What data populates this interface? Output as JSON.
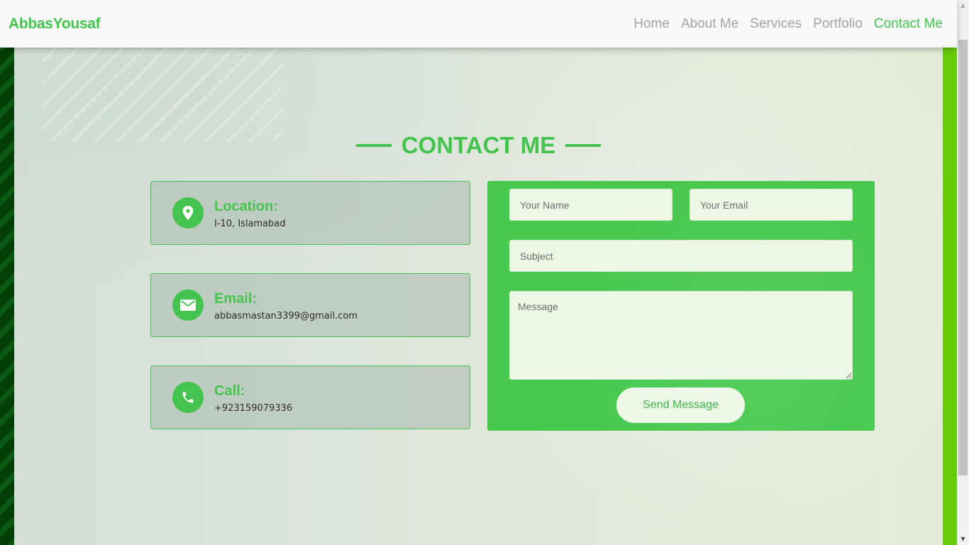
{
  "navbar": {
    "brand": "AbbasYousaf",
    "links": [
      {
        "label": "Home",
        "active": false
      },
      {
        "label": "About Me",
        "active": false
      },
      {
        "label": "Services",
        "active": false
      },
      {
        "label": "Portfolio",
        "active": false
      },
      {
        "label": "Contact Me",
        "active": true
      }
    ]
  },
  "section": {
    "title": "CONTACT ME"
  },
  "contact_info": [
    {
      "icon": "map-pin-icon",
      "title": "Location:",
      "value": "I-10, Islamabad"
    },
    {
      "icon": "envelope-icon",
      "title": "Email:",
      "value": "abbasmastan3399@gmail.com"
    },
    {
      "icon": "phone-icon",
      "title": "Call:",
      "value": "+923159079336"
    }
  ],
  "form": {
    "name_placeholder": "Your Name",
    "email_placeholder": "Your Email",
    "subject_placeholder": "Subject",
    "message_placeholder": "Message",
    "send_label": "Send Message"
  },
  "colors": {
    "accent": "#44c44e",
    "form_bg": "#47c94d",
    "right_bar": "#66cc0a",
    "navbar_bg": "#f8f9fa"
  }
}
